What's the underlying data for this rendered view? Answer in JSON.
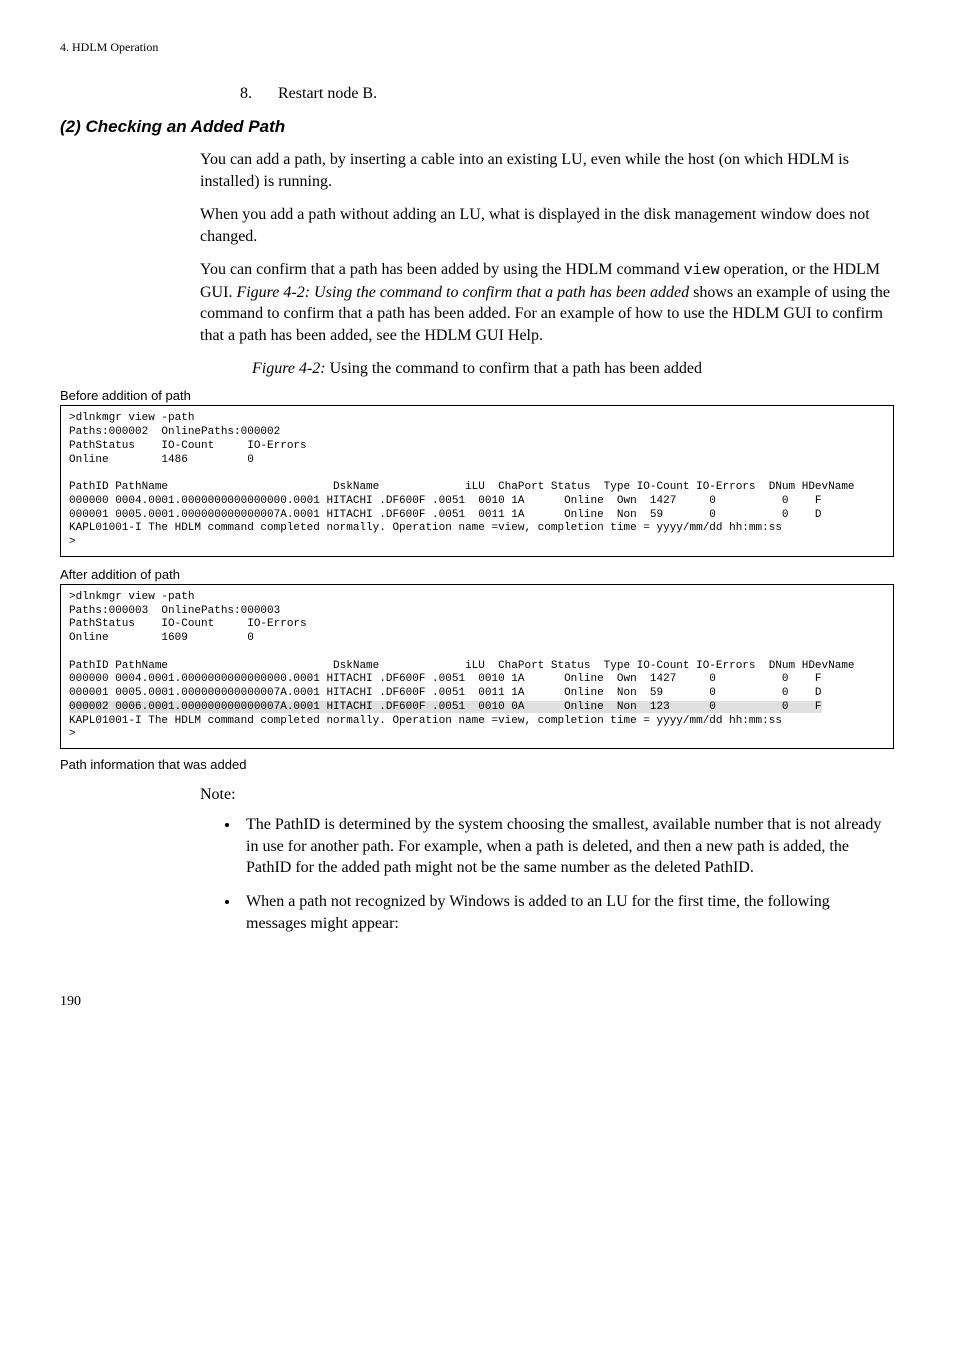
{
  "header": {
    "text": "4. HDLM Operation"
  },
  "step8": {
    "num": "8.",
    "text": "Restart node B."
  },
  "section_heading": "(2) Checking an Added Path",
  "para1": "You can add a path, by inserting a cable into an existing LU, even while the host (on which HDLM is installed) is running.",
  "para2": "When you add a path without adding an LU, what is displayed in the disk management window does not changed.",
  "para3_a": "You can confirm that a path has been added by using the HDLM command ",
  "para3_code": "view",
  "para3_b": " operation, or the HDLM GUI. ",
  "para3_fig_ref": "Figure  4-2:  Using the command to confirm that a path has been added",
  "para3_c": " shows an example of using the command to confirm that a path has been added. For an example of how to use the HDLM GUI to confirm that a path has been added, see the HDLM GUI Help.",
  "fig_caption_a": "Figure  4-2:  ",
  "fig_caption_b": "Using the command to confirm that a path has been added",
  "before_label": "Before addition of path",
  "after_label": "After addition of path",
  "path_info_label": "Path information that was added",
  "note_label": "Note:",
  "bullet1": "The PathID is determined by the system choosing the smallest, available number that is not already in use for another path. For example, when a path is deleted, and then a new path is added, the PathID for the added path might not be the same number as the deleted PathID.",
  "bullet2": "When a path not recognized by Windows is added to an LU for the first time, the following messages might appear:",
  "page_number": "190",
  "term_before": {
    "l1": ">dlnkmgr view -path",
    "l2": "Paths:000002  OnlinePaths:000002",
    "l3": "PathStatus    IO-Count     IO-Errors",
    "l4": "Online        1486         0",
    "l5": "",
    "l6": "PathID PathName                         DskName             iLU  ChaPort Status  Type IO-Count IO-Errors  DNum HDevName",
    "l7": "000000 0004.0001.0000000000000000.0001 HITACHI .DF600F .0051  0010 1A      Online  Own  1427     0          0    F",
    "l8": "000001 0005.0001.000000000000007A.0001 HITACHI .DF600F .0051  0011 1A      Online  Non  59       0          0    D",
    "l9": "KAPL01001-I The HDLM command completed normally. Operation name =view, completion time = yyyy/mm/dd hh:mm:ss",
    "l10": ">"
  },
  "term_after": {
    "l1": ">dlnkmgr view -path",
    "l2": "Paths:000003  OnlinePaths:000003",
    "l3": "PathStatus    IO-Count     IO-Errors",
    "l4": "Online        1609         0",
    "l5": "",
    "l6": "PathID PathName                         DskName             iLU  ChaPort Status  Type IO-Count IO-Errors  DNum HDevName",
    "l7": "000000 0004.0001.0000000000000000.0001 HITACHI .DF600F .0051  0010 1A      Online  Own  1427     0          0    F",
    "l8": "000001 0005.0001.000000000000007A.0001 HITACHI .DF600F .0051  0011 1A      Online  Non  59       0          0    D",
    "hl": "000002 0006.0001.000000000000007A.0001 HITACHI .DF600F .0051  0010 0A      Online  Non  123      0          0    F",
    "l9": "KAPL01001-I The HDLM command completed normally. Operation name =view, completion time = yyyy/mm/dd hh:mm:ss",
    "l10": ">"
  }
}
